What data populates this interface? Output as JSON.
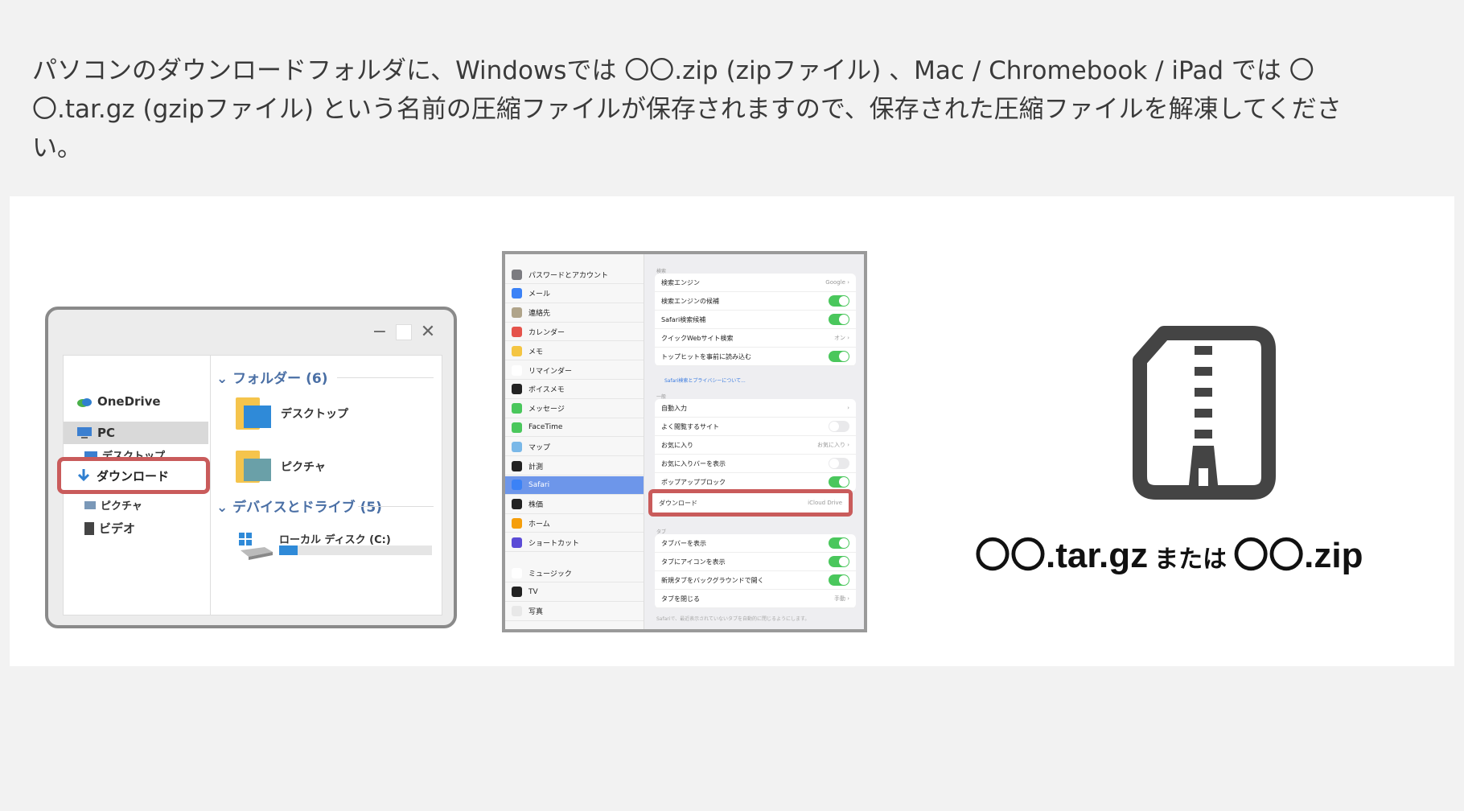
{
  "intro_text": "パソコンのダウンロードフォルダに、Windowsでは 〇〇.zip (zipファイル) 、Mac / Chromebook / iPad では 〇〇.tar.gz (gzipファイル) という名前の圧縮ファイルが保存されますので、保存された圧縮ファイルを解凍してください。",
  "windows": {
    "nav": {
      "onedrive": "OneDrive",
      "pc": "PC",
      "desktop": "デスクトップ",
      "downloads": "ダウンロード",
      "pictures": "ピクチャ",
      "videos": "ビデオ"
    },
    "folders_header": "フォルダー (6)",
    "folders": [
      "デスクトップ",
      "ピクチャ"
    ],
    "devices_header": "デバイスとドライブ (5)",
    "disk_label": "ローカル ディスク (C:)",
    "disk_used_fraction": 0.12,
    "controls": {
      "minimize": "−",
      "close": "✕"
    }
  },
  "ipad": {
    "sidebar": [
      {
        "label": "パスワードとアカウント",
        "color": "#7b7b80"
      },
      {
        "label": "メール",
        "color": "#3b82f6"
      },
      {
        "label": "連絡先",
        "color": "#b0a48a"
      },
      {
        "label": "カレンダー",
        "color": "#e5534b"
      },
      {
        "label": "メモ",
        "color": "#f4c542"
      },
      {
        "label": "リマインダー",
        "color": "#ffffff"
      },
      {
        "label": "ボイスメモ",
        "color": "#222222"
      },
      {
        "label": "メッセージ",
        "color": "#4ac75c"
      },
      {
        "label": "FaceTime",
        "color": "#4ac75c"
      },
      {
        "label": "マップ",
        "color": "#7ab8e8"
      },
      {
        "label": "計測",
        "color": "#222222"
      },
      {
        "label": "Safari",
        "color": "#3b82f6",
        "selected": true
      },
      {
        "label": "株価",
        "color": "#222222"
      },
      {
        "label": "ホーム",
        "color": "#f59e0b"
      },
      {
        "label": "ショートカット",
        "color": "#5b4bd6"
      },
      {
        "label": "ミュージック",
        "color": "#ffffff"
      },
      {
        "label": "TV",
        "color": "#222222"
      },
      {
        "label": "写真",
        "color": "#e8e8e8"
      }
    ],
    "search_section": "検索",
    "search_rows": [
      {
        "label": "検索エンジン",
        "value": "Google"
      },
      {
        "label": "検索エンジンの候補",
        "toggle": true
      },
      {
        "label": "Safari検索候補",
        "toggle": true
      },
      {
        "label": "クイックWebサイト検索",
        "value": "オン"
      },
      {
        "label": "トップヒットを事前に読み込む",
        "toggle": true
      }
    ],
    "privacy_link": "Safari検索とプライバシーについて...",
    "general_section": "一般",
    "general_rows": [
      {
        "label": "自動入力",
        "value": ""
      },
      {
        "label": "よく閲覧するサイト",
        "toggle": false
      },
      {
        "label": "お気に入り",
        "value": "お気に入り"
      },
      {
        "label": "お気に入りバーを表示",
        "toggle": false
      },
      {
        "label": "ポップアップブロック",
        "toggle": true
      }
    ],
    "download_row": {
      "label": "ダウンロード",
      "value": "iCloud Drive"
    },
    "tabs_section": "タブ",
    "tabs_rows": [
      {
        "label": "タブバーを表示",
        "toggle": true
      },
      {
        "label": "タブにアイコンを表示",
        "toggle": true
      },
      {
        "label": "新規タブをバックグラウンドで開く",
        "toggle": true
      },
      {
        "label": "タブを閉じる",
        "value": "手動"
      }
    ],
    "tabs_footnote": "Safariで、最近表示されていないタブを自動的に閉じるようにします。"
  },
  "zip": {
    "file_a": "〇〇.tar.gz",
    "connector": "または",
    "file_b": "〇〇.zip"
  }
}
